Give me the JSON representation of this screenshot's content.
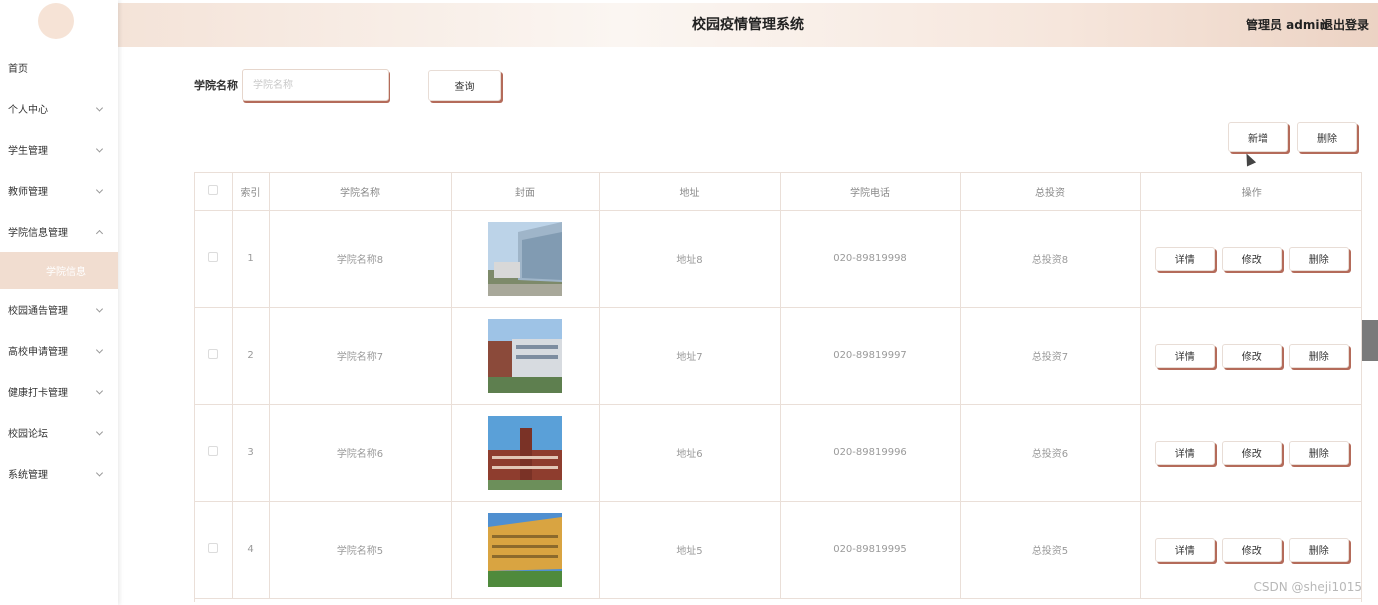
{
  "header": {
    "title": "校园疫情管理系统",
    "user": "管理员 admin",
    "logout": "退出登录"
  },
  "sidebar": {
    "items": [
      {
        "label": "首页",
        "expandable": false
      },
      {
        "label": "个人中心",
        "expandable": true
      },
      {
        "label": "学生管理",
        "expandable": true
      },
      {
        "label": "教师管理",
        "expandable": true
      },
      {
        "label": "学院信息管理",
        "expandable": true,
        "expanded": true
      },
      {
        "label": "校园通告管理",
        "expandable": true
      },
      {
        "label": "高校申请管理",
        "expandable": true
      },
      {
        "label": "健康打卡管理",
        "expandable": true
      },
      {
        "label": "校园论坛",
        "expandable": true
      },
      {
        "label": "系统管理",
        "expandable": true
      }
    ],
    "active_sub": "学院信息"
  },
  "search": {
    "label": "学院名称",
    "placeholder": "学院名称",
    "value": "",
    "button": "查询"
  },
  "toolbar": {
    "add": "新增",
    "delete": "删除"
  },
  "table": {
    "columns": [
      "索引",
      "学院名称",
      "封面",
      "地址",
      "学院电话",
      "总投资",
      "操作"
    ],
    "rows": [
      {
        "index": "1",
        "name": "学院名称8",
        "address": "地址8",
        "phone": "020-89819998",
        "investment": "总投资8"
      },
      {
        "index": "2",
        "name": "学院名称7",
        "address": "地址7",
        "phone": "020-89819997",
        "investment": "总投资7"
      },
      {
        "index": "3",
        "name": "学院名称6",
        "address": "地址6",
        "phone": "020-89819996",
        "investment": "总投资6"
      },
      {
        "index": "4",
        "name": "学院名称5",
        "address": "地址5",
        "phone": "020-89819995",
        "investment": "总投资5"
      }
    ],
    "actions": {
      "detail": "详情",
      "edit": "修改",
      "delete": "删除"
    }
  },
  "watermark": "CSDN @sheji1015",
  "colors": {
    "accent_shadow": "#b46b5a",
    "header_bg": "#f4e3d8",
    "active_sub_bg": "#f1ddd0"
  }
}
